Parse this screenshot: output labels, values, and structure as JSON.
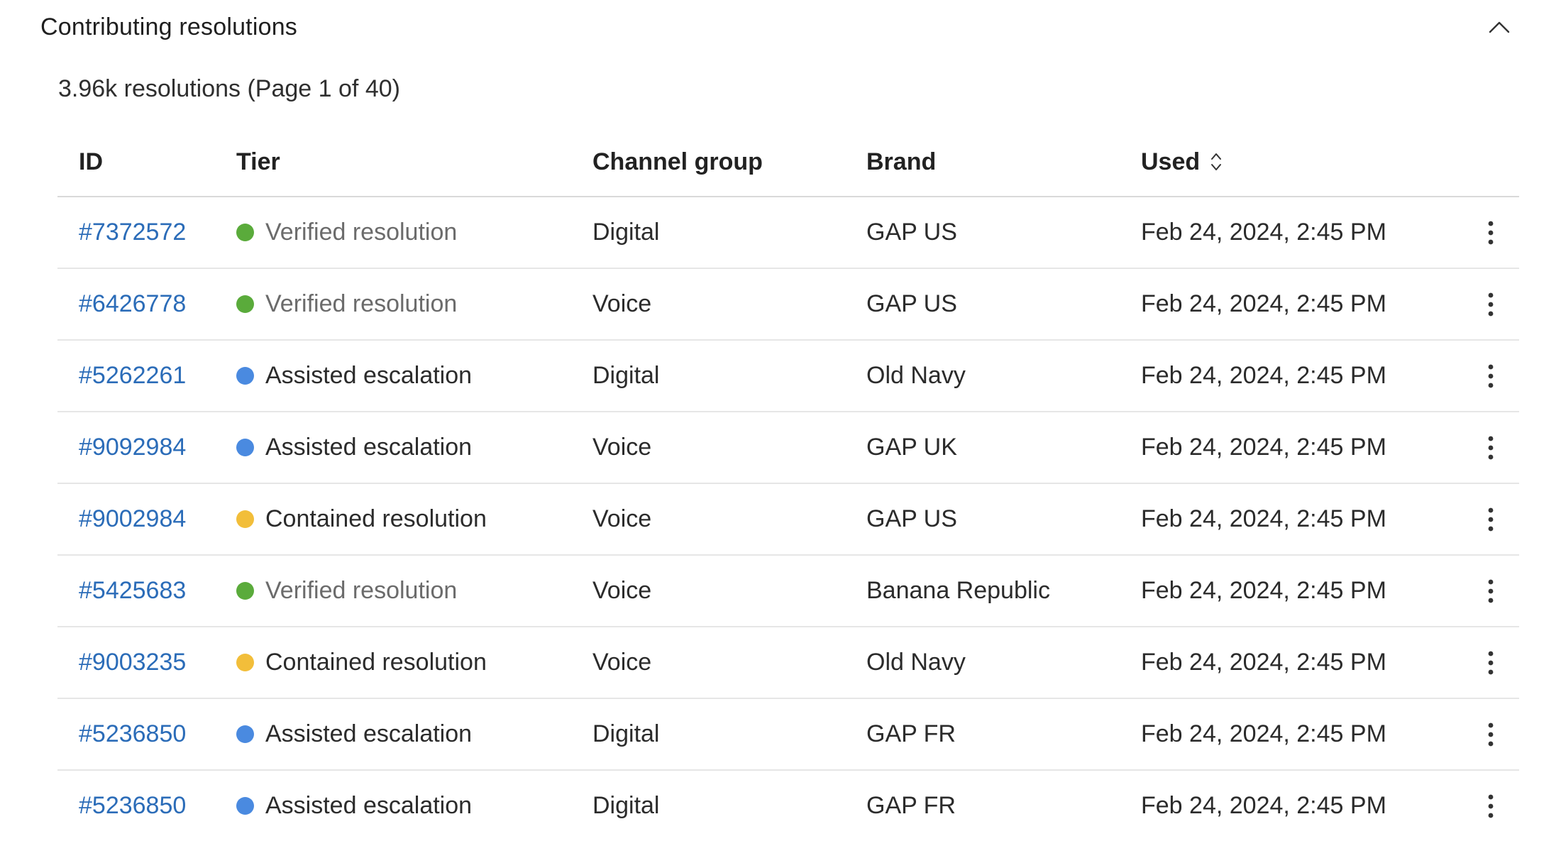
{
  "panel": {
    "title": "Contributing resolutions",
    "summary": "3.96k resolutions (Page 1 of 40)"
  },
  "colors": {
    "link": "#2b6cb8",
    "verified": "#5aab3b",
    "assisted": "#4a8ae0",
    "contained": "#f2be3a"
  },
  "icons": {
    "collapse": "chevron-up-icon",
    "sort": "sort-icon",
    "row_menu": "kebab-menu-icon"
  },
  "table": {
    "headers": {
      "id": "ID",
      "tier": "Tier",
      "channel": "Channel group",
      "brand": "Brand",
      "used": "Used"
    },
    "rows": [
      {
        "id": "#7372572",
        "tier": "Verified resolution",
        "tier_key": "verified",
        "channel": "Digital",
        "brand": "GAP US",
        "used": "Feb 24, 2024, 2:45 PM"
      },
      {
        "id": "#6426778",
        "tier": "Verified resolution",
        "tier_key": "verified",
        "channel": "Voice",
        "brand": "GAP US",
        "used": "Feb 24, 2024, 2:45 PM"
      },
      {
        "id": "#5262261",
        "tier": "Assisted escalation",
        "tier_key": "assisted",
        "channel": "Digital",
        "brand": "Old Navy",
        "used": "Feb 24, 2024, 2:45 PM"
      },
      {
        "id": "#9092984",
        "tier": "Assisted escalation",
        "tier_key": "assisted",
        "channel": "Voice",
        "brand": "GAP UK",
        "used": "Feb 24, 2024, 2:45 PM"
      },
      {
        "id": "#9002984",
        "tier": "Contained resolution",
        "tier_key": "contained",
        "channel": "Voice",
        "brand": "GAP US",
        "used": "Feb 24, 2024, 2:45 PM"
      },
      {
        "id": "#5425683",
        "tier": "Verified resolution",
        "tier_key": "verified",
        "channel": "Voice",
        "brand": "Banana Republic",
        "used": "Feb 24, 2024, 2:45 PM"
      },
      {
        "id": "#9003235",
        "tier": "Contained resolution",
        "tier_key": "contained",
        "channel": "Voice",
        "brand": "Old Navy",
        "used": "Feb 24, 2024, 2:45 PM"
      },
      {
        "id": "#5236850",
        "tier": "Assisted escalation",
        "tier_key": "assisted",
        "channel": "Digital",
        "brand": "GAP FR",
        "used": "Feb 24, 2024, 2:45 PM"
      },
      {
        "id": "#5236850",
        "tier": "Assisted escalation",
        "tier_key": "assisted",
        "channel": "Digital",
        "brand": "GAP FR",
        "used": "Feb 24, 2024, 2:45 PM"
      }
    ]
  }
}
